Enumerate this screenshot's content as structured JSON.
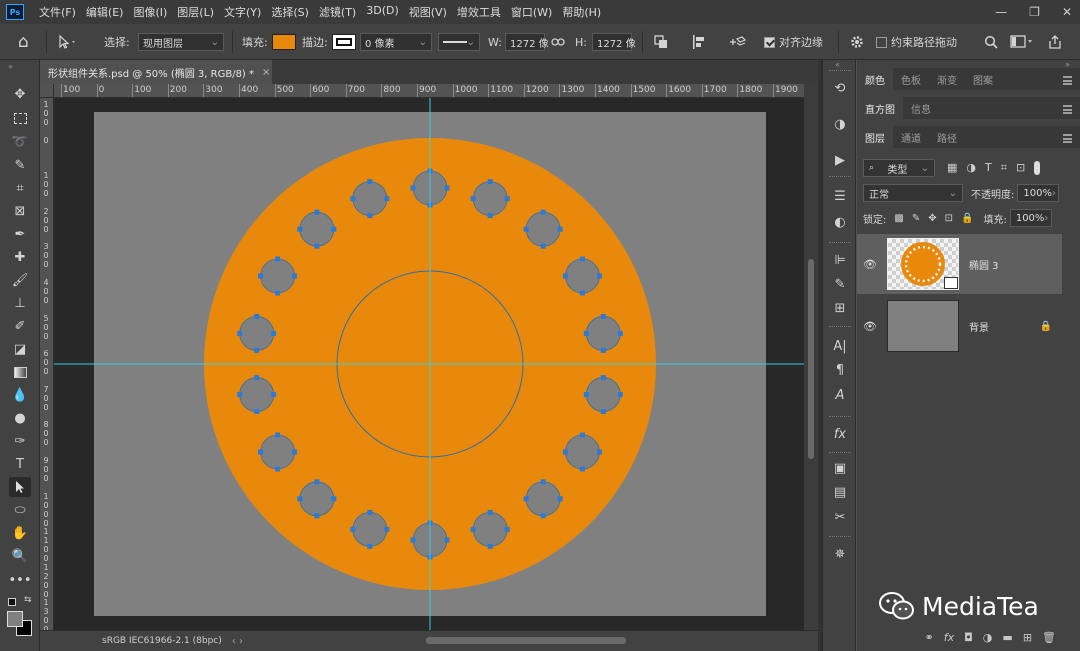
{
  "app": {
    "logo": "Ps"
  },
  "menu": [
    "文件(F)",
    "编辑(E)",
    "图像(I)",
    "图层(L)",
    "文字(Y)",
    "选择(S)",
    "滤镜(T)",
    "3D(D)",
    "视图(V)",
    "增效工具",
    "窗口(W)",
    "帮助(H)"
  ],
  "window_controls": {
    "minimize": "—",
    "restore": "❐",
    "close": "✕"
  },
  "options": {
    "home_icon": "⌂",
    "select_label": "选择:",
    "select_value": "现用图层",
    "fill_label": "填充:",
    "fill_color": "#e8890c",
    "stroke_label": "描边:",
    "stroke_size": "0 像素",
    "w_label": "W:",
    "w_value": "1272 像",
    "h_label": "H:",
    "h_value": "1272 像",
    "align_edges": "对齐边缘",
    "align_edges_checked": true,
    "constrain_path": "约束路径拖动",
    "constrain_path_checked": false
  },
  "document": {
    "tab_title": "形状组件关系.psd @ 50% (椭圆 3, RGB/8) *",
    "close_icon": "×",
    "color_profile": "sRGB IEC61966-2.1 (8bpc)",
    "nav_arrows": "‹   ›"
  },
  "ruler_h": [
    "100",
    "0",
    "100",
    "200",
    "300",
    "400",
    "500",
    "600",
    "700",
    "800",
    "900",
    "1000",
    "1100",
    "1200",
    "1300",
    "1400",
    "1500",
    "1600",
    "1700",
    "1800",
    "1900"
  ],
  "ruler_v": [
    "1\n0\n0",
    "0",
    "1\n0\n0",
    "2\n0\n0",
    "3\n0\n0",
    "4\n0\n0",
    "5\n0\n0",
    "6\n0\n0",
    "7\n0\n0",
    "8\n0\n0",
    "9\n0\n0",
    "1\n0\n0\n0",
    "1\n1\n0\n0",
    "1\n2\n0\n0",
    "1\n3\n0\n0",
    "1\n4\n0\n0"
  ],
  "canvas": {
    "background": "#808080",
    "shape_color": "#e8890c",
    "hole_color": "#808080",
    "guide_color": "#33d1e6",
    "anchor_color": "#2b7bd6",
    "hole_count": 18
  },
  "panels": {
    "group1_tabs": [
      "颜色",
      "色板",
      "渐变",
      "图案"
    ],
    "group2_tabs": [
      "直方图",
      "信息"
    ],
    "group3_tabs": [
      "图层",
      "通道",
      "路径"
    ],
    "filter_kind": "类型",
    "blend_mode": "正常",
    "opacity_label": "不透明度:",
    "opacity_value": "100%",
    "lock_label": "锁定:",
    "fill_label": "填充:",
    "fill_value": "100%",
    "layers": [
      {
        "name": "椭圆 3",
        "selected": true,
        "visible": true
      },
      {
        "name": "背景",
        "selected": false,
        "visible": true,
        "locked": true
      }
    ]
  },
  "watermark": {
    "text": "MediaTea"
  }
}
